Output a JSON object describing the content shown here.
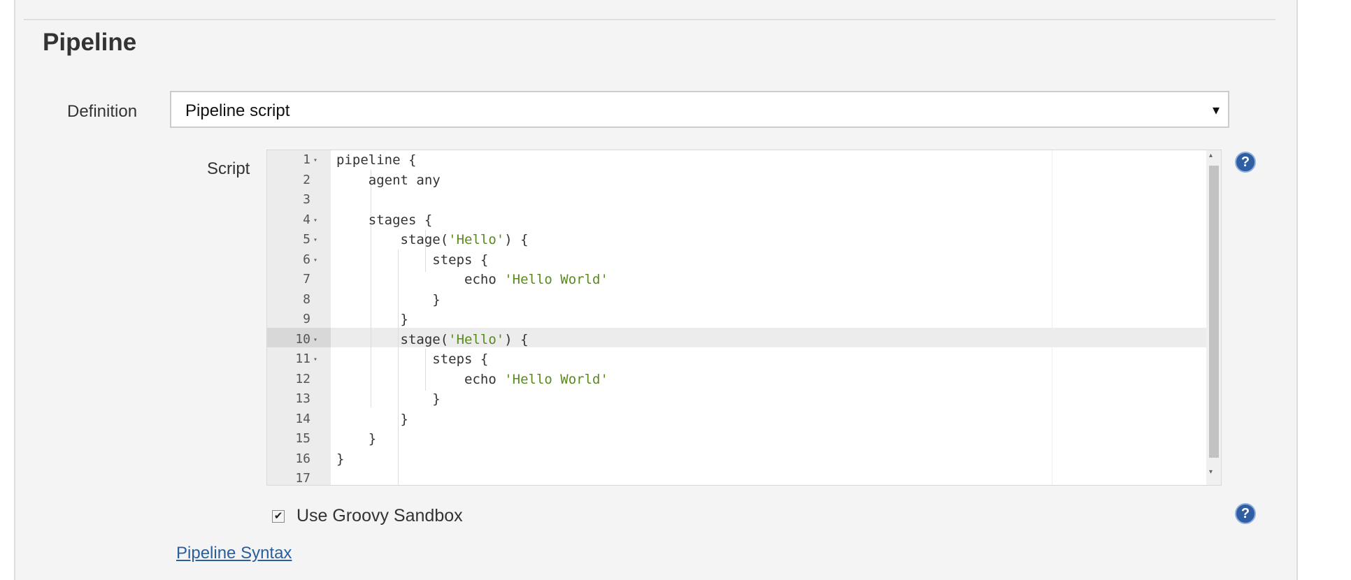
{
  "section": {
    "title": "Pipeline"
  },
  "definition": {
    "label": "Definition",
    "selected": "Pipeline script",
    "arrow": "▾"
  },
  "script": {
    "label": "Script",
    "lines": [
      {
        "n": "1",
        "fold": true,
        "code": [
          {
            "t": "pipeline {"
          }
        ]
      },
      {
        "n": "2",
        "fold": false,
        "code": [
          {
            "t": "    agent any"
          }
        ]
      },
      {
        "n": "3",
        "fold": false,
        "code": [
          {
            "t": ""
          }
        ]
      },
      {
        "n": "4",
        "fold": true,
        "code": [
          {
            "t": "    stages {"
          }
        ]
      },
      {
        "n": "5",
        "fold": true,
        "code": [
          {
            "t": "        stage("
          },
          {
            "t": "'Hello'",
            "s": true
          },
          {
            "t": ") {"
          }
        ]
      },
      {
        "n": "6",
        "fold": true,
        "code": [
          {
            "t": "            steps {"
          }
        ]
      },
      {
        "n": "7",
        "fold": false,
        "code": [
          {
            "t": "                echo "
          },
          {
            "t": "'Hello World'",
            "s": true
          }
        ]
      },
      {
        "n": "8",
        "fold": false,
        "code": [
          {
            "t": "            }"
          }
        ]
      },
      {
        "n": "9",
        "fold": false,
        "code": [
          {
            "t": "        }"
          }
        ]
      },
      {
        "n": "10",
        "fold": true,
        "code": [
          {
            "t": "        stage("
          },
          {
            "t": "'Hello'",
            "s": true
          },
          {
            "t": ") {"
          }
        ]
      },
      {
        "n": "11",
        "fold": true,
        "code": [
          {
            "t": "            steps {"
          }
        ]
      },
      {
        "n": "12",
        "fold": false,
        "code": [
          {
            "t": "                echo "
          },
          {
            "t": "'Hello World'",
            "s": true
          }
        ]
      },
      {
        "n": "13",
        "fold": false,
        "code": [
          {
            "t": "            }"
          }
        ]
      },
      {
        "n": "14",
        "fold": false,
        "code": [
          {
            "t": "        }"
          }
        ]
      },
      {
        "n": "15",
        "fold": false,
        "code": [
          {
            "t": "    }"
          }
        ]
      },
      {
        "n": "16",
        "fold": false,
        "code": [
          {
            "t": "}"
          }
        ]
      },
      {
        "n": "17",
        "fold": false,
        "code": [
          {
            "t": ""
          }
        ]
      }
    ],
    "active_line": "10",
    "fold_glyph": "▾",
    "scroll_up_glyph": "▴",
    "scroll_down_glyph": "▾"
  },
  "help_glyph": "?",
  "sandbox": {
    "label": "Use Groovy Sandbox",
    "checked": true,
    "check_glyph": "✔"
  },
  "syntax_link": {
    "label": "Pipeline Syntax"
  },
  "colors": {
    "string": "#5a8a1e",
    "link": "#2b5e9c",
    "help_icon": "#2f5ea3"
  }
}
